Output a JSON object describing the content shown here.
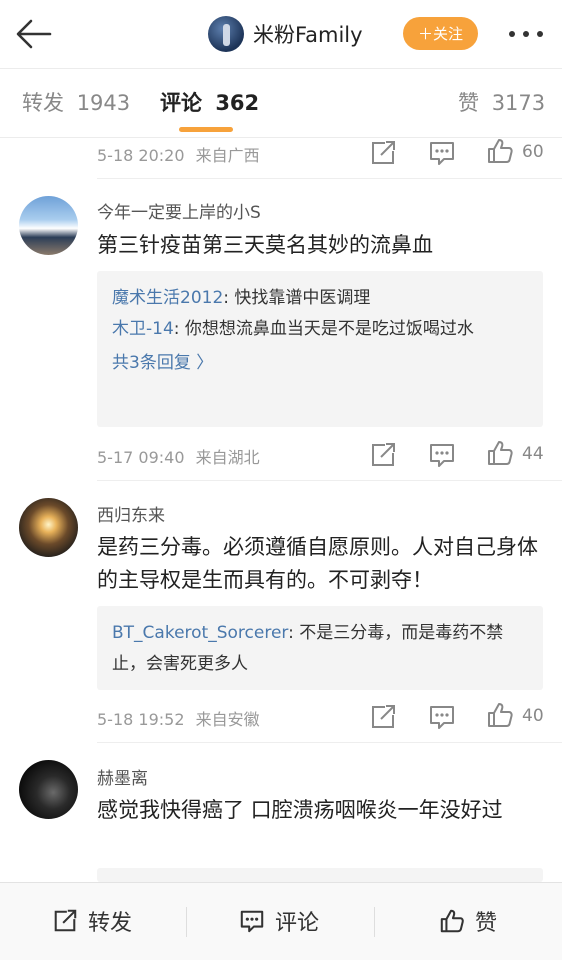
{
  "header": {
    "account_name": "米粉Family",
    "follow_label": "＋关注"
  },
  "tabs": [
    {
      "label": "转发",
      "count": "1943"
    },
    {
      "label": "评论",
      "count": "362"
    },
    {
      "label": "赞",
      "count": "3173"
    }
  ],
  "comments": [
    {
      "partial": true,
      "time": "5-18 20:20",
      "source": "来自广西",
      "likes": "60"
    },
    {
      "user": "今年一定要上岸的小S",
      "text": "第三针疫苗第三天莫名其妙的流鼻血",
      "replies": [
        {
          "user": "魔术生活2012",
          "text": ": 快找靠谱中医调理"
        },
        {
          "user": "木卫-14",
          "text": ": 你想想流鼻血当天是不是吃过饭喝过水"
        }
      ],
      "more_replies": "共3条回复 〉",
      "time": "5-17 09:40",
      "source": "来自湖北",
      "likes": "44"
    },
    {
      "user": "西归东来",
      "text": "是药三分毒。必须遵循自愿原则。人对自己身体的主导权是生而具有的。不可剥夺！",
      "replies": [
        {
          "user": "BT_Cakerot_Sorcerer",
          "text": ": 不是三分毒，而是毒药不禁止，会害死更多人"
        }
      ],
      "time": "5-18 19:52",
      "source": "来自安徽",
      "likes": "40"
    },
    {
      "user": "赫墨离",
      "text": "感觉我快得癌了 口腔溃疡咽喉炎一年没好过"
    }
  ],
  "bottom_bar": {
    "repost_label": "转发",
    "comment_label": "评论",
    "like_label": "赞"
  },
  "colors": {
    "accent": "#f7a23b",
    "link": "#4a78ac"
  }
}
